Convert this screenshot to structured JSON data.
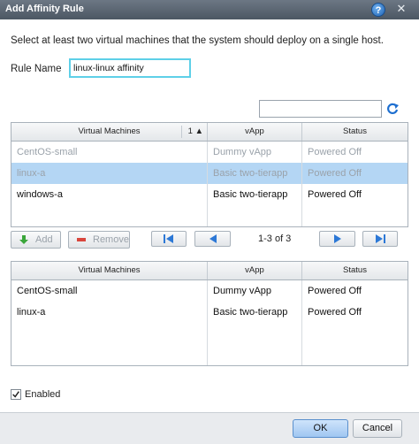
{
  "dialog": {
    "title": "Add Affinity Rule",
    "help_label": "?",
    "close_label": "✕"
  },
  "instructions": "Select at least two virtual machines that the system should deploy on a single host.",
  "rule_name": {
    "label": "Rule Name",
    "value": "linux-linux affinity"
  },
  "search": {
    "value": ""
  },
  "available_grid": {
    "columns": [
      "Virtual Machines",
      "vApp",
      "Status"
    ],
    "sort_indicator": "1 ▲",
    "rows": [
      {
        "vm": "CentOS-small",
        "vapp": "Dummy vApp",
        "status": "Powered Off",
        "state": "dim"
      },
      {
        "vm": "linux-a",
        "vapp": "Basic two-tierapp",
        "status": "Powered Off",
        "state": "selected"
      },
      {
        "vm": "windows-a",
        "vapp": "Basic two-tierapp",
        "status": "Powered Off",
        "state": "normal"
      }
    ]
  },
  "toolbar": {
    "add_label": "Add",
    "remove_label": "Remove",
    "page_info": "1-3 of 3"
  },
  "selected_grid": {
    "columns": [
      "Virtual Machines",
      "vApp",
      "Status"
    ],
    "rows": [
      {
        "vm": "CentOS-small",
        "vapp": "Dummy vApp",
        "status": "Powered Off"
      },
      {
        "vm": "linux-a",
        "vapp": "Basic two-tierapp",
        "status": "Powered Off"
      }
    ]
  },
  "enabled": {
    "label": "Enabled",
    "checked": true
  },
  "buttons": {
    "ok": "OK",
    "cancel": "Cancel"
  },
  "colors": {
    "accent": "#5ed0e8",
    "selection": "#b4d6f4",
    "titlebar": "#58636f"
  },
  "icons": [
    "help-icon",
    "close-icon",
    "refresh-icon",
    "add-icon",
    "remove-icon",
    "first-page-icon",
    "prev-page-icon",
    "next-page-icon",
    "last-page-icon",
    "checkbox-icon"
  ]
}
